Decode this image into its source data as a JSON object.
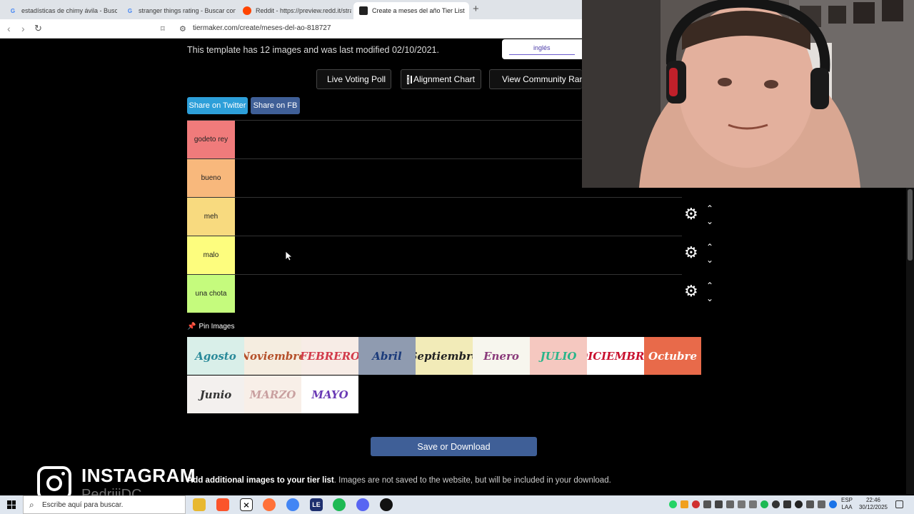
{
  "browser": {
    "tabs": [
      {
        "label": "estadísticas de chimy ávila - Buscar c",
        "favicon": "G",
        "active": false
      },
      {
        "label": "stranger things rating - Buscar con G",
        "favicon": "G",
        "active": false
      },
      {
        "label": "Reddit - https://preview.redd.it/stran",
        "favicon": "reddit",
        "active": false
      },
      {
        "label": "Create a meses del año Tier List",
        "favicon": "tiermaker",
        "active": true
      }
    ],
    "close_symbol": "×",
    "new_tab_symbol": "+",
    "url": "tiermaker.com/create/meses-del-ao-818727"
  },
  "page": {
    "template_info": "This template has 12 images and was last modified 02/10/2021.",
    "language": "inglés",
    "buttons": {
      "live_voting": "Live Voting Poll",
      "alignment_chart": "Alignment Chart",
      "community_rank": "View Community Ran"
    },
    "share": {
      "twitter": "Share on Twitter",
      "facebook": "Share on FB"
    },
    "tiers": [
      {
        "label": "godeto rey",
        "color": "#f07b7b"
      },
      {
        "label": "bueno",
        "color": "#f8b87c"
      },
      {
        "label": "meh",
        "color": "#f8da7f"
      },
      {
        "label": "malo",
        "color": "#fdfd7e"
      },
      {
        "label": "una chota",
        "color": "#c5fb7d"
      }
    ],
    "pin_images_label": "Pin Images",
    "pin_images": [
      {
        "label": "Agosto",
        "bg": "#d9efe9",
        "fg": "#2a8a9a"
      },
      {
        "label": "Noviembre",
        "bg": "#f5ede0",
        "fg": "#b5502a"
      },
      {
        "label": "FEBRERO",
        "bg": "#f7ece6",
        "fg": "#d23a4a"
      },
      {
        "label": "Abril",
        "bg": "#8f9bb0",
        "fg": "#1a3a7a"
      },
      {
        "label": "Septiembre",
        "bg": "#f2ebb8",
        "fg": "#222222"
      },
      {
        "label": "Enero",
        "bg": "#f7f6ee",
        "fg": "#8a3a7a"
      },
      {
        "label": "JULIO",
        "bg": "#f5c8c0",
        "fg": "#2ab58a"
      },
      {
        "label": "DICIEMBRE",
        "bg": "#ffffff",
        "fg": "#c8102e"
      },
      {
        "label": "Octubre",
        "bg": "#e86a4a",
        "fg": "#ffffff"
      },
      {
        "label": "Junio",
        "bg": "#f3f0ee",
        "fg": "#333333"
      },
      {
        "label": "MARZO",
        "bg": "#f8efe8",
        "fg": "#c9a0a0"
      },
      {
        "label": "MAYO",
        "bg": "#ffffff",
        "fg": "#6a3ab5"
      }
    ],
    "save_button": "Save or Download",
    "add_images_bold": "Add additional images to your tier list",
    "add_images_rest": ". Images are not saved to the website, but will be included in your download."
  },
  "overlay": {
    "instagram_title": "INSTAGRAM",
    "instagram_user": "PedriiiDC"
  },
  "taskbar": {
    "search_placeholder": "Escribe aquí para buscar.",
    "lang_top": "ESP",
    "lang_bottom": "LAA",
    "time": "22:46",
    "date": "30/12/2025"
  },
  "icons": {
    "gear": "⚙",
    "arrow_up": "⌃",
    "arrow_down": "⌄",
    "pin": "📌"
  }
}
